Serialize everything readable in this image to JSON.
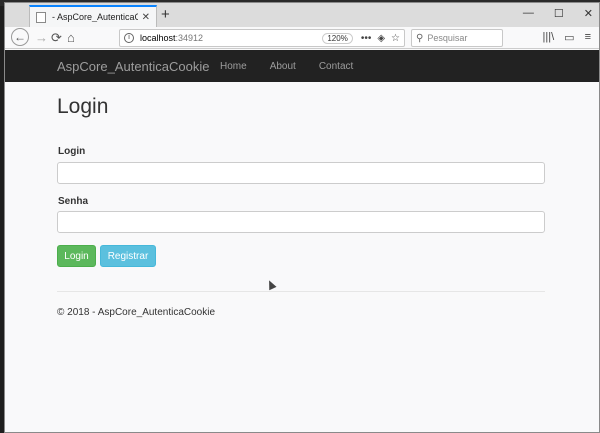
{
  "browser": {
    "tab_title": "- AspCore_AutenticaCookie",
    "tab_close": "✕",
    "new_tab": "+",
    "url_host": "localhost",
    "url_port": ":34912",
    "zoom": "120%",
    "search_placeholder": "Pesquisar",
    "controls": {
      "minimize": "—",
      "maximize": "☐",
      "close": "✕"
    },
    "nav": {
      "back": "←",
      "forward": "→",
      "reload": "⟳",
      "home": "⌂"
    },
    "url_icons": [
      "•••",
      "◈",
      "☆"
    ],
    "toolbar_icons": [
      "|||\\",
      "▭",
      "≡"
    ]
  },
  "site": {
    "brand": "AspCore_AutenticaCookie",
    "menu": [
      "Home",
      "About",
      "Contact"
    ]
  },
  "page": {
    "title": "Login",
    "login_label": "Login",
    "password_label": "Senha",
    "login_button": "Login",
    "register_button": "Registrar",
    "footer": "© 2018 - AspCore_AutenticaCookie"
  }
}
